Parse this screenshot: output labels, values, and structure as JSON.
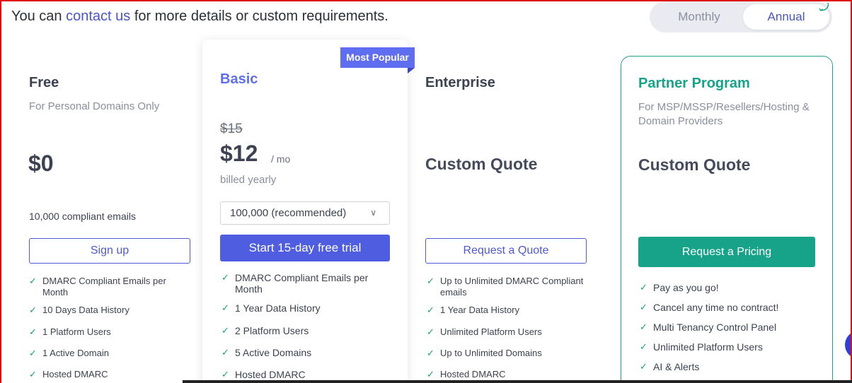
{
  "header": {
    "text_before": "You can ",
    "link": "contact us",
    "text_after": " for more details or custom requirements."
  },
  "billing_toggle": {
    "monthly": "Monthly",
    "annual": "Annual",
    "selected": "Annual"
  },
  "colors": {
    "accent": "#4f5de0",
    "partner": "#17a38a",
    "check": "#1aa36f"
  },
  "plans": {
    "free": {
      "name": "Free",
      "subtitle": "For Personal Domains Only",
      "price": "$0",
      "emails": "10,000 compliant emails",
      "cta": "Sign up",
      "features": [
        "DMARC Compliant Emails per Month",
        "10 Days Data History",
        "1 Platform Users",
        "1 Active Domain",
        "Hosted DMARC"
      ]
    },
    "basic": {
      "badge": "Most Popular",
      "name": "Basic",
      "old_price": "$15",
      "price": "$12",
      "period": "/ mo",
      "billing": "billed yearly",
      "select_value": "100,000 (recommended)",
      "cta": "Start 15-day free trial",
      "features": [
        "DMARC Compliant Emails per Month",
        "1 Year Data History",
        "2 Platform Users",
        "5 Active Domains",
        "Hosted DMARC"
      ]
    },
    "enterprise": {
      "name": "Enterprise",
      "price": "Custom Quote",
      "cta": "Request a Quote",
      "features": [
        "Up to Unlimited DMARC Compliant emails",
        "1 Year Data History",
        "Unlimited Platform Users",
        "Up to Unlimited Domains",
        "Hosted DMARC"
      ]
    },
    "partner": {
      "name": "Partner Program",
      "subtitle": "For MSP/MSSP/Resellers/Hosting & Domain Providers",
      "price": "Custom Quote",
      "cta": "Request a Pricing",
      "features": [
        "Pay as you go!",
        "Cancel any time no contract!",
        "Multi Tenancy Control Panel",
        "Unlimited Platform Users",
        "AI & Alerts"
      ]
    }
  }
}
